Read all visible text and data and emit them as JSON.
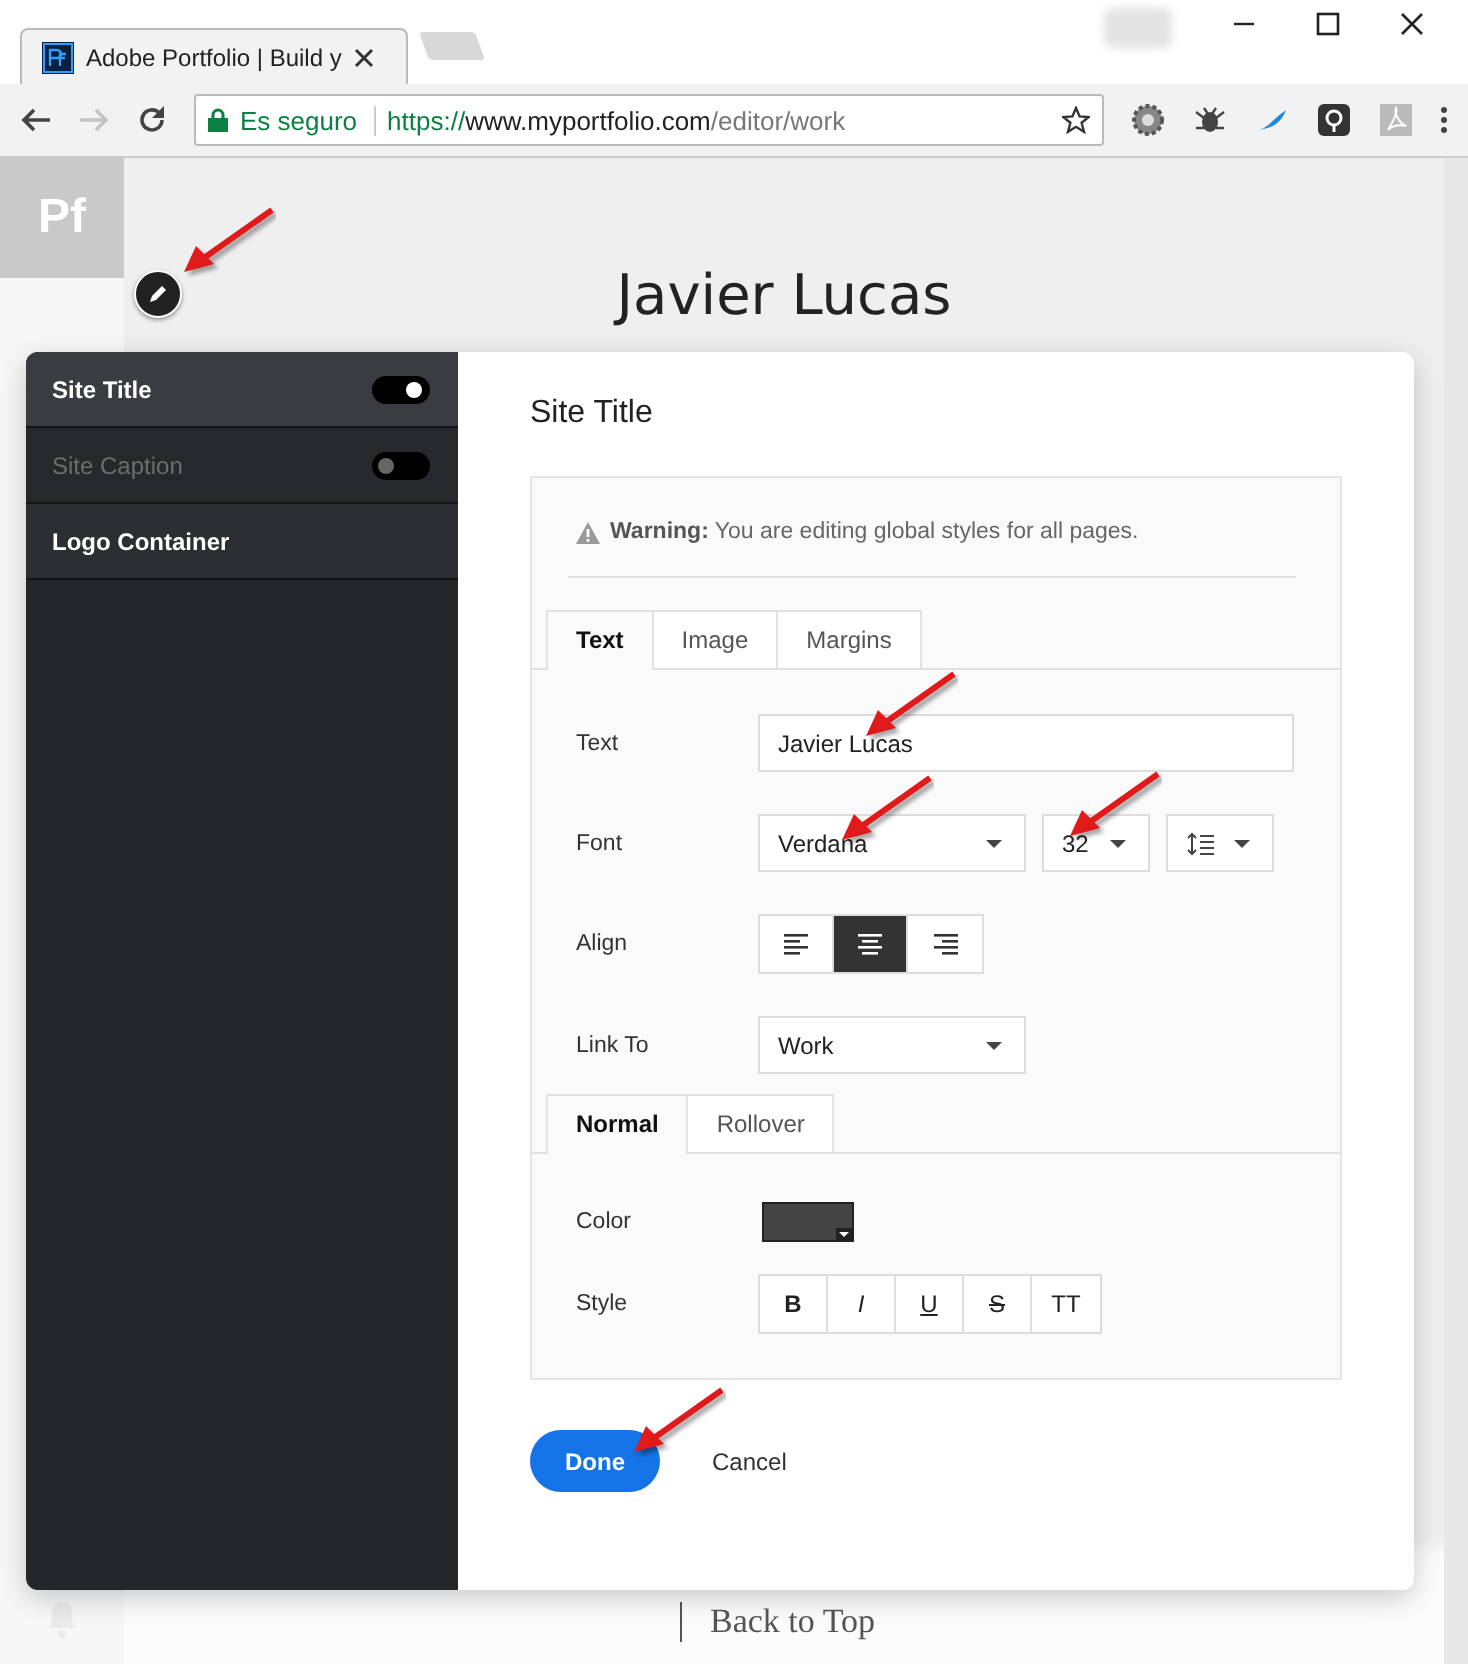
{
  "browser": {
    "tab_title": "Adobe Portfolio | Build y",
    "secure_label": "Es seguro",
    "url": {
      "scheme": "https://",
      "host": "www.myportfolio.com",
      "path": "/editor/work"
    }
  },
  "page": {
    "logo": "Pf",
    "site_title": "Javier Lucas",
    "footer_link": "Back to Top",
    "edit_button": {
      "arrow": true
    }
  },
  "panel": {
    "items": [
      {
        "label": "Site Title",
        "kind": "toggle",
        "on": true,
        "disabled": false
      },
      {
        "label": "Site Caption",
        "kind": "toggle",
        "on": false,
        "disabled": true
      },
      {
        "label": "Logo Container",
        "kind": "plain",
        "disabled": false
      }
    ]
  },
  "editor": {
    "heading": "Site Title",
    "warning": "**Warning:** You are editing global styles for all pages.",
    "tabs": [
      {
        "label": "Text",
        "selected": true
      },
      {
        "label": "Image",
        "selected": false
      },
      {
        "label": "Margins",
        "selected": false
      }
    ],
    "text": {
      "label": "Text",
      "value": "Javier Lucas",
      "arrow": true
    },
    "font": {
      "label": "Font",
      "value": "Verdana",
      "arrow": true,
      "size": "32",
      "size_arrow": true
    },
    "align": {
      "label": "Align",
      "options": [
        {
          "kind": "left",
          "selected": false
        },
        {
          "kind": "center",
          "selected": true
        },
        {
          "kind": "right",
          "selected": false
        }
      ]
    },
    "link_to": {
      "label": "Link To",
      "value": "Work"
    },
    "state_tabs": [
      {
        "label": "Normal",
        "selected": true
      },
      {
        "label": "Rollover",
        "selected": false
      }
    ],
    "color": {
      "label": "Color"
    },
    "style": {
      "label": "Style",
      "buttons": [
        {
          "text": "B",
          "kind": "bold"
        },
        {
          "text": "I",
          "kind": "italic"
        },
        {
          "text": "U",
          "kind": "underline"
        },
        {
          "text": "S",
          "kind": "strike"
        },
        {
          "text": "TT",
          "kind": "caps"
        }
      ]
    },
    "done": {
      "label": "Done",
      "arrow": true
    },
    "cancel": "Cancel"
  }
}
